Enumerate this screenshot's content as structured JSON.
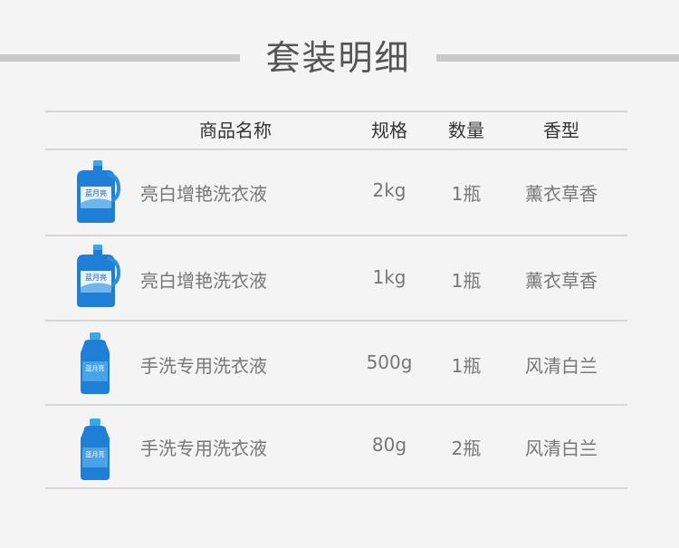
{
  "title": "套装明细",
  "headers": {
    "name": "商品名称",
    "spec": "规格",
    "qty": "数量",
    "scent": "香型"
  },
  "rows": [
    {
      "name": "亮白增艳洗衣液",
      "spec": "2kg",
      "qty": "1瓶",
      "scent": "薰衣草香",
      "image": "large-detergent-bottle-icon",
      "logo": "蓝月亮"
    },
    {
      "name": "亮白增艳洗衣液",
      "spec": "1kg",
      "qty": "1瓶",
      "scent": "薰衣草香",
      "image": "large-detergent-bottle-icon",
      "logo": "蓝月亮"
    },
    {
      "name": "手洗专用洗衣液",
      "spec": "500g",
      "qty": "1瓶",
      "scent": "风清白兰",
      "image": "handwash-bottle-icon",
      "logo": "蓝月亮"
    },
    {
      "name": "手洗专用洗衣液",
      "spec": "80g",
      "qty": "2瓶",
      "scent": "风清白兰",
      "image": "handwash-bottle-icon",
      "logo": "蓝月亮"
    }
  ],
  "colors": {
    "bottle": "#1f7fd6",
    "cap": "#3aa7e8",
    "text": "#777777",
    "header_text": "#333333",
    "rule": "#d6d6d6"
  }
}
